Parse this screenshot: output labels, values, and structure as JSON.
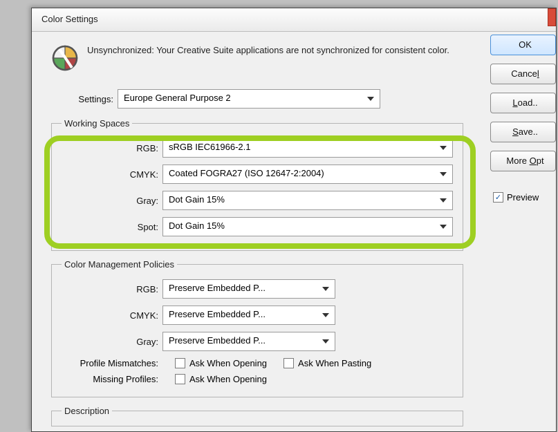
{
  "window": {
    "title": "Color Settings"
  },
  "sync": {
    "text": "Unsynchronized: Your Creative Suite applications are not synchronized for consistent color."
  },
  "buttons": {
    "ok": "OK",
    "cancel1": "Cance",
    "cancel2": "l",
    "load1": "L",
    "load2": "oad..",
    "save1": "S",
    "save2": "ave..",
    "more1": "More ",
    "more2": "O",
    "more3": "pt"
  },
  "preview": {
    "label1": "Previe",
    "label2": "w",
    "checked": "✓"
  },
  "settings": {
    "label": "Settings:",
    "value": "Europe General Purpose 2"
  },
  "workingSpaces": {
    "legend": "Working Spaces",
    "rgbLabel1": "R",
    "rgbLabel2": "G",
    "rgbLabel3": "B:",
    "rgbValue": "sRGB IEC61966-2.1",
    "cmykLabel1": "C",
    "cmykLabel2": "M",
    "cmykLabel3": "YK:",
    "cmykValue": "Coated FOGRA27 (ISO 12647-2:2004)",
    "grayLabel1": "G",
    "grayLabel2": "ray:",
    "grayValue": "Dot Gain 15%",
    "spotLabel1": "S",
    "spotLabel2": "pot:",
    "spotValue": "Dot Gain 15%"
  },
  "policies": {
    "legend": "Color Management Policies",
    "rgbLabel1": "RG",
    "rgbLabel2": "B",
    "rgbLabel3": ":",
    "rgbValue": "Preserve Embedded P...",
    "cmykLabel1": "C",
    "cmykLabel2": "M",
    "cmykLabel3": "YK:",
    "cmykValue": "Preserve Embedded P...",
    "grayLabel1": "Gra",
    "grayLabel2": "y",
    "grayLabel3": ":",
    "grayValue": "Preserve Embedded P...",
    "mismatchLabel": "Profile Mismatches:",
    "askOpening1": "Ask ",
    "askOpening2": "W",
    "askOpening3": "hen Opening",
    "askPasting1": "Ask Whe",
    "askPasting2": "n",
    "askPasting3": " Pasting",
    "missingLabel": "Missing Profiles:",
    "askOpeningM1": "As",
    "askOpeningM2": "k",
    "askOpeningM3": " When Opening"
  },
  "description": {
    "legend": "Description"
  }
}
